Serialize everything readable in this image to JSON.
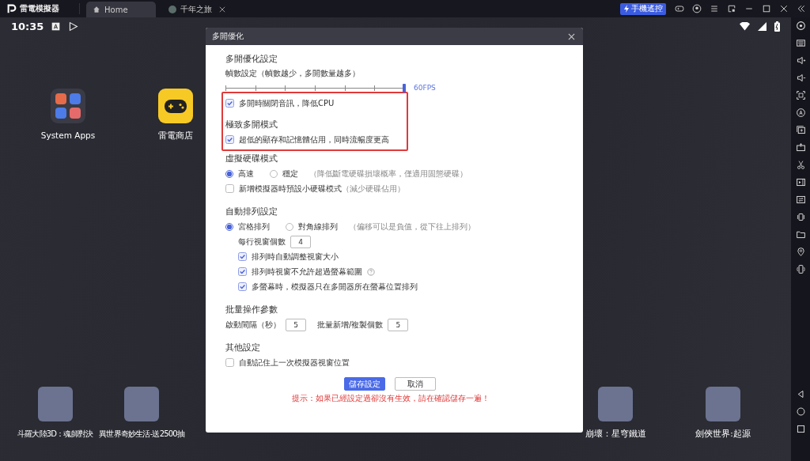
{
  "titlebar": {
    "app_name": "雷電模擬器",
    "tabs": [
      {
        "label": "Home",
        "selected": true,
        "closable": false
      },
      {
        "label": "千年之旅",
        "selected": false,
        "closable": true
      }
    ],
    "remote_button": "手機遙控"
  },
  "statusbar": {
    "time": "10:35"
  },
  "home": {
    "top_apps": [
      {
        "label": "System Apps",
        "kind": "folder"
      },
      {
        "label": "雷電商店",
        "kind": "store"
      }
    ],
    "bottom_apps_left": [
      {
        "label": "斗羅大陸3D：魂師對決"
      },
      {
        "label": "異世界奇妙生活-送2500抽"
      }
    ],
    "bottom_apps_right": [
      {
        "label": "崩壞：星穹鐵道"
      },
      {
        "label": "劍俠世界:起源"
      }
    ]
  },
  "dialog": {
    "window_title": "多開優化",
    "blocks": [
      {
        "highlighted": false,
        "rows": [
          {
            "kind": "heading",
            "text": "多開優化設定"
          },
          {
            "kind": "slider",
            "label": "幀數設定（幀數越少，多開數量越多）",
            "level": 1,
            "reading": "60FPS"
          }
        ]
      },
      {
        "highlighted": true,
        "rows": [
          {
            "kind": "checkbox",
            "label": "多開時關閉音訊，降低CPU",
            "checked": true
          },
          {
            "kind": "heading",
            "text": "極致多開模式"
          },
          {
            "kind": "checkbox",
            "label": "超低的顯存和記憶體佔用，同時流暢度更高",
            "checked": true
          }
        ]
      },
      {
        "highlighted": false,
        "rows": [
          {
            "kind": "heading",
            "text": "虛擬硬碟模式"
          },
          {
            "kind": "radios",
            "options": [
              {
                "label": "高速",
                "selected": true
              },
              {
                "label": "穩定",
                "note": "（降低斷電硬碟損壞概率，僅適用固態硬碟）",
                "selected": false
              }
            ]
          },
          {
            "kind": "checkbox",
            "label": "新增模擬器時預設小硬碟模式",
            "note": "（減少硬碟佔用）",
            "checked": false
          },
          {
            "kind": "heading",
            "text": "自動排列設定"
          },
          {
            "kind": "radios",
            "options": [
              {
                "label": "宮格排列",
                "selected": true
              },
              {
                "label": "對角線排列",
                "note": "（偏移可以是負值，從下往上排列）",
                "selected": false
              }
            ],
            "children": [
              {
                "kind": "fields",
                "fields": [
                  {
                    "label": "每行視窗個數",
                    "value": "4"
                  }
                ]
              },
              {
                "kind": "checkbox",
                "label": "排列時自動調整視窗大小",
                "checked": true
              },
              {
                "kind": "help-checkbox",
                "label": "排列時視窗不允許超過螢幕範圍",
                "checked": true
              },
              {
                "kind": "checkbox",
                "label": "多螢幕時，模擬器只在多開器所在螢幕位置排列",
                "checked": true
              }
            ]
          },
          {
            "kind": "heading",
            "text": "批量操作參數"
          },
          {
            "kind": "fields",
            "fields": [
              {
                "label": "啟動間隔（秒）",
                "value": "5"
              },
              {
                "label": "批量新增/複製個數",
                "value": "5"
              }
            ]
          },
          {
            "kind": "heading",
            "text": "其他設定"
          },
          {
            "kind": "checkbox",
            "label": "自動記住上一次模擬器視窗位置",
            "checked": false
          }
        ]
      }
    ],
    "buttons": [
      {
        "label": "儲存設定",
        "kind": "primary"
      },
      {
        "label": "取消",
        "kind": "secondary"
      }
    ],
    "hint": "提示：如果已經設定過卻沒有生效，請在確認儲存一遍！"
  }
}
